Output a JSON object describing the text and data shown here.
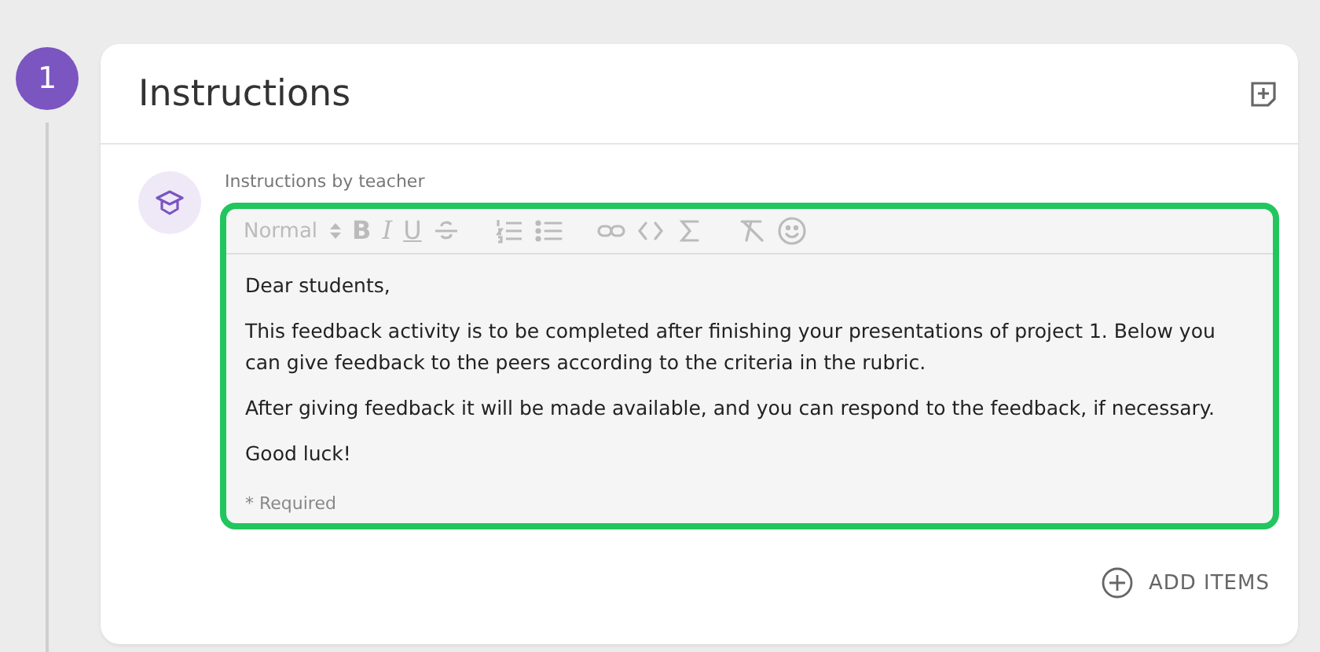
{
  "step": {
    "number": "1"
  },
  "card": {
    "title": "Instructions"
  },
  "instructions": {
    "label": "Instructions by teacher",
    "toolbar": [
      {
        "kind": "select",
        "text": "Normal"
      },
      {
        "kind": "bold",
        "text": "B"
      },
      {
        "kind": "italic",
        "text": "I"
      },
      {
        "kind": "underline",
        "text": "U"
      },
      {
        "kind": "strike"
      },
      {
        "kind": "gap"
      },
      {
        "kind": "ordered"
      },
      {
        "kind": "bullets"
      },
      {
        "kind": "gap"
      },
      {
        "kind": "link"
      },
      {
        "kind": "code"
      },
      {
        "kind": "sigma"
      },
      {
        "kind": "gap"
      },
      {
        "kind": "clear"
      },
      {
        "kind": "emoji"
      }
    ],
    "paragraphs": [
      "Dear students,",
      "This feedback activity is to be completed after finishing your presentations of project 1. Below you can give feedback to the peers according to the criteria in the rubric.",
      "After giving feedback it will be made available, and you can respond to the feedback, if necessary.",
      "Good luck!"
    ],
    "hint": "* Required"
  },
  "add_button": {
    "label": "ADD ITEMS"
  }
}
